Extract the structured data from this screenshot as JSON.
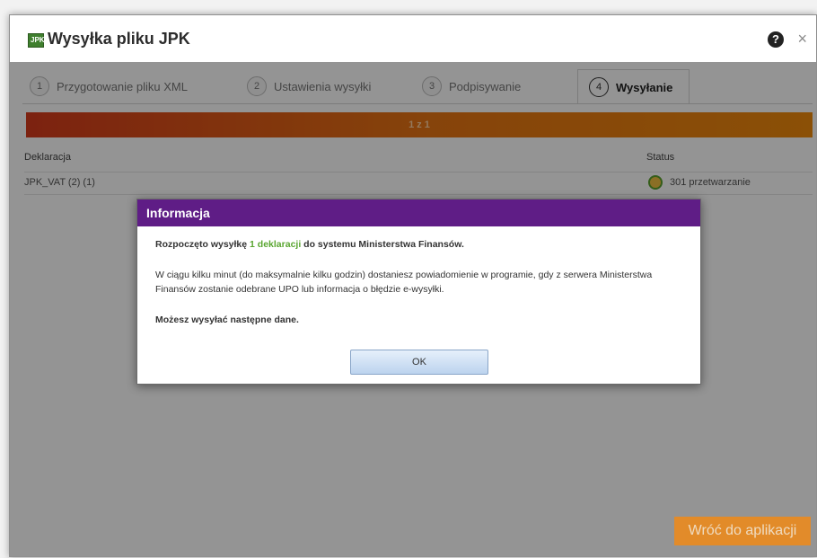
{
  "window": {
    "title": "Wysyłka pliku JPK",
    "icon_text": "JPK",
    "help_label": "?",
    "close_label": "×"
  },
  "tabs": [
    {
      "num": "1",
      "label": "Przygotowanie pliku XML",
      "active": false
    },
    {
      "num": "2",
      "label": "Ustawienia wysyłki",
      "active": false
    },
    {
      "num": "3",
      "label": "Podpisywanie",
      "active": false
    },
    {
      "num": "4",
      "label": "Wysyłanie",
      "active": true
    }
  ],
  "progress": {
    "text": "1 z 1",
    "value": 1.0
  },
  "table": {
    "headers": {
      "declaration": "Deklaracja",
      "status": "Status"
    },
    "rows": [
      {
        "declaration": "JPK_VAT (2) (1)",
        "status": "301 przetwarzanie"
      }
    ]
  },
  "dialog": {
    "title": "Informacja",
    "line1_pre": "Rozpoczęto wysyłkę ",
    "line1_highlight": "1 deklaracji",
    "line1_post": " do systemu Ministerstwa Finansów.",
    "line2": "W ciągu kilku minut (do maksymalnie kilku godzin) dostaniesz powiadomienie w programie, gdy z serwera Ministerstwa Finansów zostanie odebrane UPO lub informacja o błędzie e-wysyłki.",
    "line3": "Możesz wysyłać następne dane.",
    "ok_label": "OK"
  },
  "footer": {
    "back_button": "Wróć do aplikacji"
  },
  "colors": {
    "accent_purple": "#5f1d86",
    "progress_orange": "#e77413",
    "highlight_green": "#5aa631"
  }
}
